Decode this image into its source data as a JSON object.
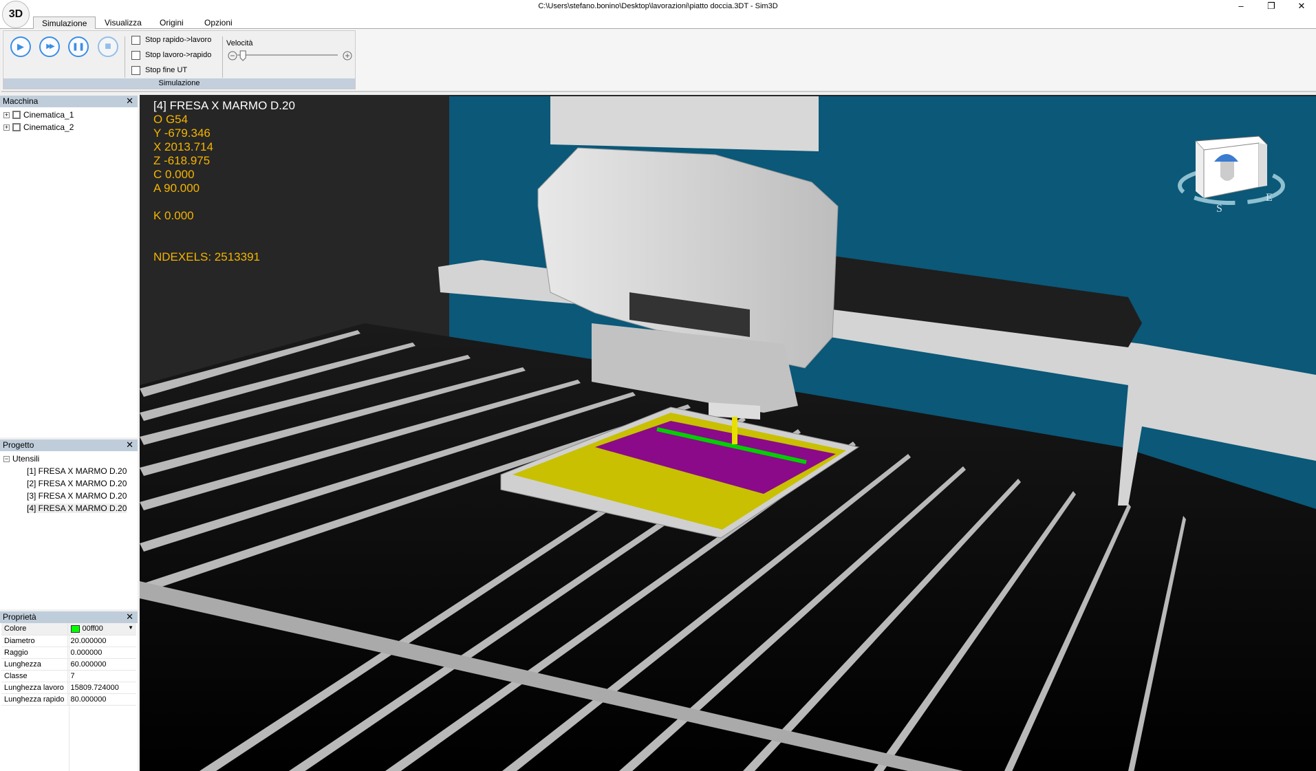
{
  "window": {
    "title": "C:\\Users\\stefano.bonino\\Desktop\\lavorazioni\\piatto doccia.3DT - Sim3D",
    "app_logo": "3D",
    "minimize": "–",
    "restore": "❐",
    "close": "✕"
  },
  "tabs": [
    {
      "label": "Simulazione",
      "active": true
    },
    {
      "label": "Visualizza"
    },
    {
      "label": "Origini"
    },
    {
      "label": "Opzioni"
    }
  ],
  "ribbon": {
    "group_name": "Simulazione",
    "buttons": [
      {
        "icon": "play-icon",
        "glyph": "▶"
      },
      {
        "icon": "fast-forward-icon",
        "glyph": "▶▶"
      },
      {
        "icon": "pause-icon",
        "glyph": "❚❚"
      },
      {
        "icon": "stop-icon",
        "glyph": "■"
      }
    ],
    "checkboxes": [
      {
        "label": "Stop rapido->lavoro",
        "checked": false
      },
      {
        "label": "Stop lavoro->rapido",
        "checked": false
      },
      {
        "label": "Stop fine UT",
        "checked": false
      }
    ],
    "speed_label": "Velocità",
    "speed_value_fraction": 0.03
  },
  "machine_panel": {
    "title": "Macchina",
    "items": [
      "Cinematica_1",
      "Cinematica_2"
    ]
  },
  "project_panel": {
    "title": "Progetto",
    "root": "Utensili",
    "tools": [
      "[1] FRESA X MARMO D.20",
      "[2] FRESA X MARMO D.20",
      "[3] FRESA X MARMO D.20",
      "[4] FRESA X MARMO D.20"
    ],
    "selected_index": 3
  },
  "properties_panel": {
    "title": "Proprietà",
    "rows": [
      {
        "name": "Colore",
        "value": "00ff00",
        "swatch": "#00ff00"
      },
      {
        "name": "Diametro",
        "value": "20.000000"
      },
      {
        "name": "Raggio",
        "value": "0.000000"
      },
      {
        "name": "Lunghezza",
        "value": "60.000000"
      },
      {
        "name": "Classe",
        "value": "7"
      },
      {
        "name": "Lunghezza lavoro",
        "value": "15809.724000"
      },
      {
        "name": "Lunghezza rapido",
        "value": "80.000000"
      }
    ]
  },
  "viewport": {
    "tool_name": "[4] FRESA X MARMO D.20",
    "origin": "O G54",
    "y": "Y -679.346",
    "x": "X 2013.714",
    "z": "Z -618.975",
    "c": "C 0.000",
    "a": "A 90.000",
    "k": "K 0.000",
    "ndexels": "NDEXELS: 2513391",
    "view_cube_labels": [
      "S",
      "E"
    ],
    "colors": {
      "text": "#f4b400",
      "wall": "#0b5878",
      "stock": "#c8c000",
      "machined": "#8a0a8a",
      "toolpath": "#00d000"
    }
  }
}
